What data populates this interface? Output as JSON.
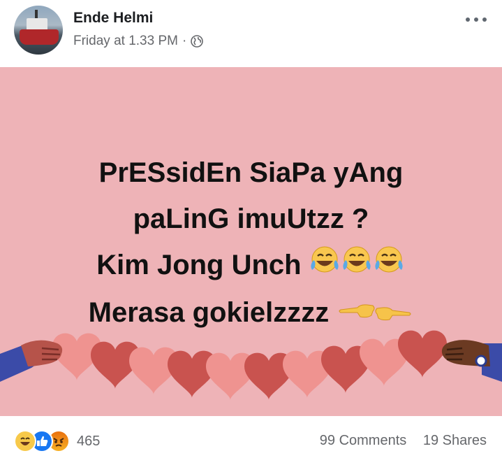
{
  "post": {
    "author": "Ende Helmi",
    "timestamp": "Friday at 1.33 PM",
    "separator": "·",
    "privacy_icon": "globe-icon",
    "menu_icon": "more-options-icon",
    "background_color": "#eeb3b7",
    "text_lines": [
      "PrESsidEn SiaPa yAng",
      "paLinG imuUtzz ?",
      "Kim Jong Unch",
      "Merasa gokielzzzz"
    ],
    "line3_emojis": [
      "laughing-tears-emoji",
      "laughing-tears-emoji",
      "laughing-tears-emoji"
    ],
    "line4_emojis": [
      "pointing-left-hand-emoji",
      "pointing-right-hand-emoji"
    ]
  },
  "footer": {
    "reaction_icons": [
      "haha-reaction-icon",
      "like-reaction-icon",
      "angry-reaction-icon"
    ],
    "reaction_count": "465",
    "comments": "99 Comments",
    "shares": "19 Shares"
  }
}
